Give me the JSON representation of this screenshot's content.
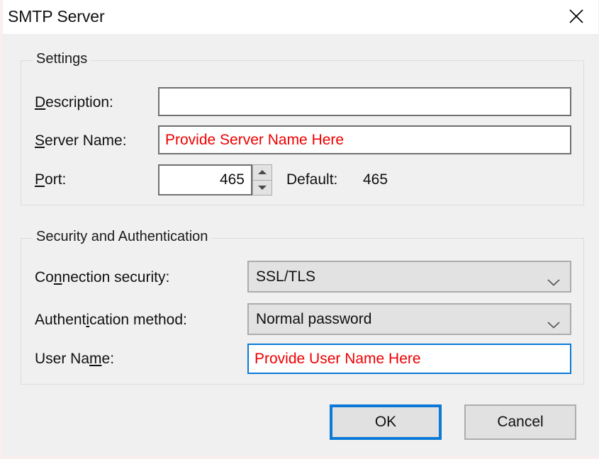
{
  "window": {
    "title": "SMTP Server",
    "close_icon": "close-icon"
  },
  "settings_group": {
    "legend": "Settings",
    "description": {
      "label_pre": "D",
      "label_post": "escription:",
      "value": "",
      "placeholder": ""
    },
    "server_name": {
      "label_pre": "S",
      "label_post": "erver Name:",
      "value": "Provide Server Name Here"
    },
    "port": {
      "label_pre": "P",
      "label_post": "ort:",
      "value": "465",
      "default_label": "Default:",
      "default_value": "465",
      "spin_up_icon": "triangle-up-icon",
      "spin_down_icon": "triangle-down-icon"
    }
  },
  "security_group": {
    "legend": "Security and Authentication",
    "connection_security": {
      "label_a": "Co",
      "label_acc": "n",
      "label_b": "nection security:",
      "value": "SSL/TLS",
      "chevron_icon": "chevron-down-icon"
    },
    "authentication_method": {
      "label_a": "Authent",
      "label_acc": "i",
      "label_b": "cation method:",
      "value": "Normal password",
      "chevron_icon": "chevron-down-icon"
    },
    "user_name": {
      "label_a": "User Na",
      "label_acc": "m",
      "label_b": "e:",
      "value": "Provide User Name Here"
    }
  },
  "footer": {
    "ok_label": "OK",
    "cancel_label": "Cancel"
  },
  "colors": {
    "accent_blue": "#0a7ad6",
    "error_red": "#ee0000",
    "dialog_bg": "#f0f0f0",
    "control_gray": "#e2e2e2"
  }
}
